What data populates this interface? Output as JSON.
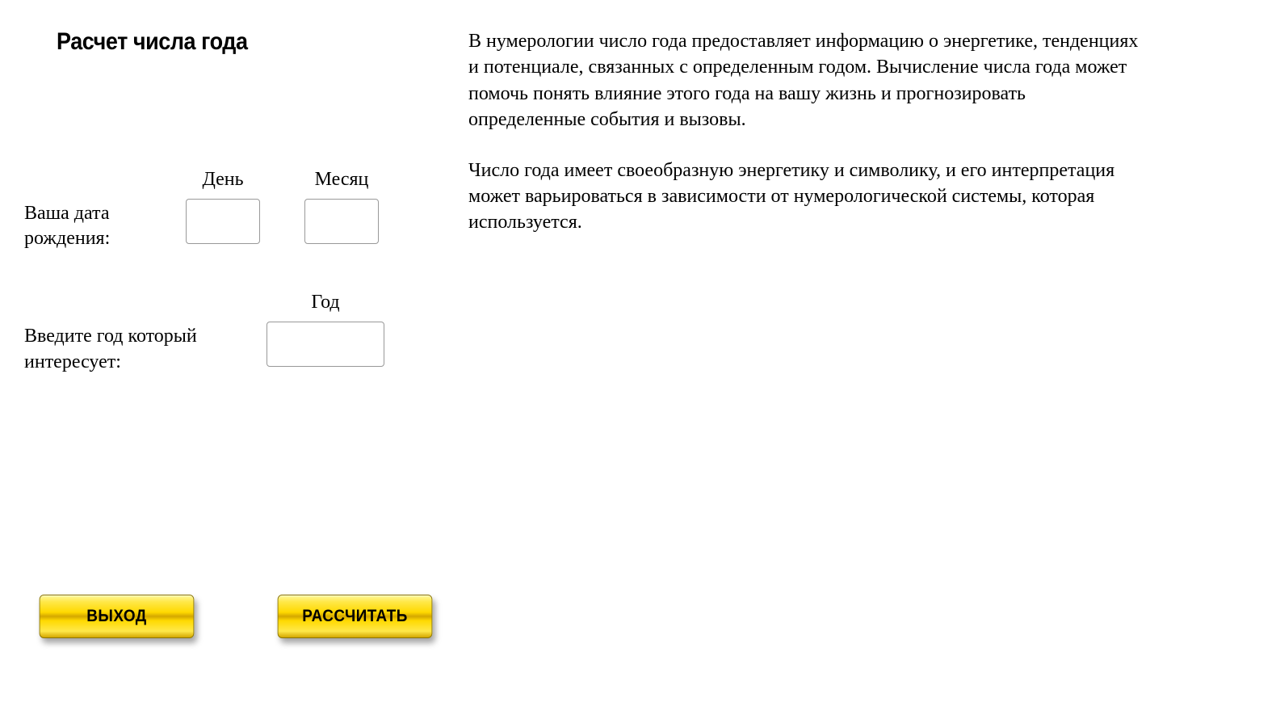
{
  "title": "Расчет числа года",
  "form": {
    "birthdate_label": "Ваша дата рождения:",
    "day_label": "День",
    "month_label": "Месяц",
    "day_value": "",
    "month_value": "",
    "year_interest_label": "Введите год который интересует:",
    "year_label": "Год",
    "year_value": ""
  },
  "description": {
    "p1": "В нумерологии число года предоставляет информацию о энергетике, тенденциях и потенциале, связанных с определенным годом. Вычисление числа года может помочь понять влияние этого года на вашу жизнь и прогнозировать определенные события и вызовы.",
    "p2": "Число года имеет своеобразную энергетику и символику, и его интерпретация может варьироваться в зависимости от нумерологической системы, которая используется."
  },
  "buttons": {
    "exit": "ВЫХОД",
    "calculate": "РАССЧИТАТЬ"
  }
}
